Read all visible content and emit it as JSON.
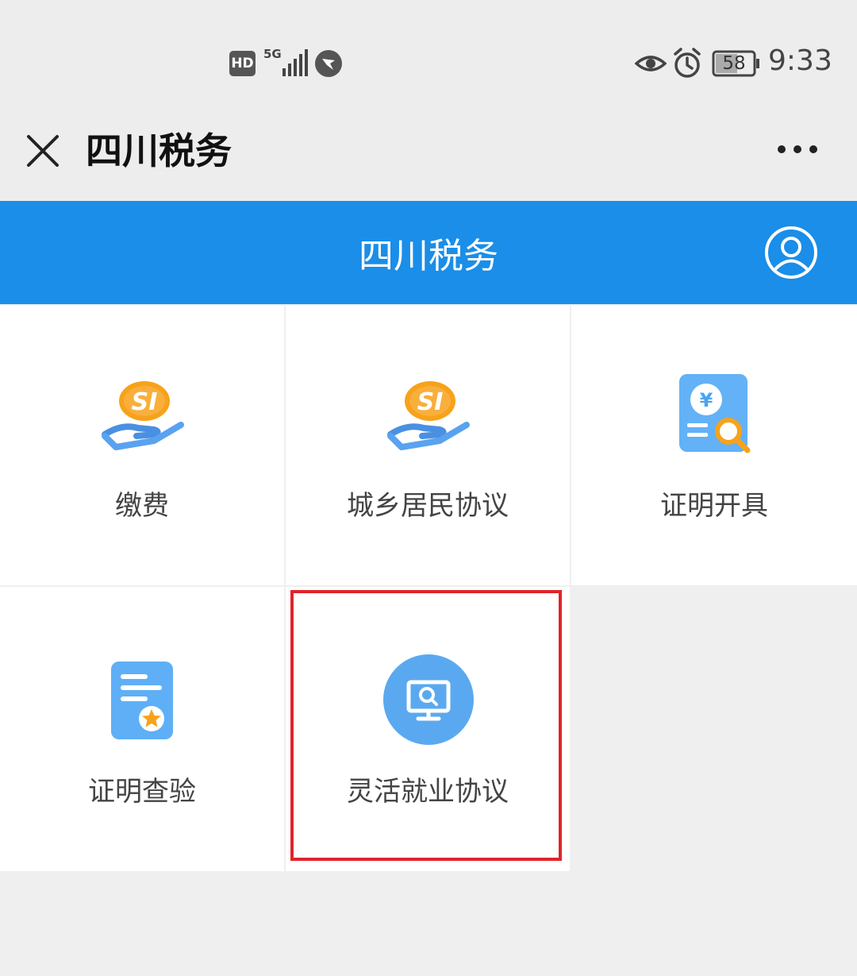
{
  "status_bar": {
    "hd_label": "HD",
    "network_label": "5G",
    "battery_level": "58",
    "time": "9:33",
    "icons": [
      "hd-icon",
      "signal-icon",
      "app-notification-icon",
      "eye-icon",
      "alarm-icon",
      "battery-icon"
    ]
  },
  "title_bar": {
    "title": "四川税务",
    "close_icon": "close-icon",
    "more_icon": "more-icon"
  },
  "header": {
    "title": "四川税务",
    "user_icon": "user-icon",
    "background_color": "#1a8ee8"
  },
  "grid": {
    "tiles": [
      {
        "label": "缴费",
        "icon": "social-insurance-hand-icon"
      },
      {
        "label": "城乡居民协议",
        "icon": "social-insurance-hand-icon"
      },
      {
        "label": "证明开具",
        "icon": "certificate-search-icon"
      },
      {
        "label": "证明查验",
        "icon": "certificate-star-icon"
      },
      {
        "label": "灵活就业协议",
        "icon": "monitor-search-icon"
      }
    ]
  },
  "highlight_color": "#e0242c"
}
